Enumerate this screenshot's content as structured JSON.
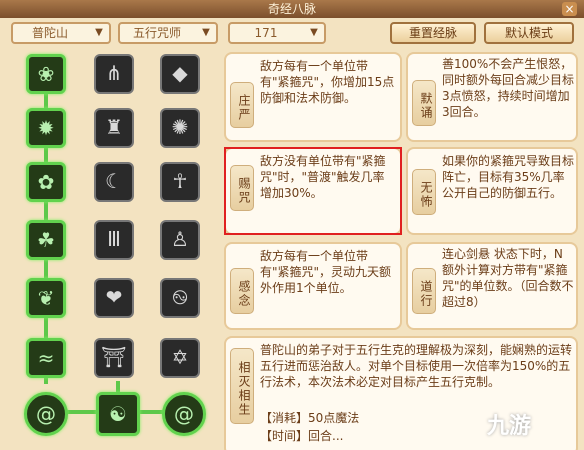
{
  "window": {
    "title": "奇经八脉",
    "close_icon": "×"
  },
  "toolbar": {
    "school_select": "普陀山",
    "category_select": "五行咒师",
    "points_select": "171",
    "reset_button": "重置经脉",
    "default_button": "默认模式"
  },
  "skills": [
    {
      "name": "庄严",
      "description": "敌方每有一个单位带有\"紧箍咒\"，你增加15点防御和法术防御。"
    },
    {
      "name": "默诵",
      "description": "善100%不会产生恨怒，同时额外每回合减少目标3点愤怒，持续时间增加3回合。"
    },
    {
      "name": "赐咒",
      "description": "敌方没有单位带有\"紧箍咒\"时，\"普渡\"触发几率增加30%。"
    },
    {
      "name": "无怖",
      "description": "如果你的紧箍咒导致目标阵亡，目标有35%几率公开自己的防御五行。"
    },
    {
      "name": "感念",
      "description": "敌方每有一个单位带有\"紧箍咒\"，灵动九天额外作用1个单位。"
    },
    {
      "name": "道行",
      "description": "连心剑悬 状态下时，N额外计算对方带有\"紧箍咒\"的单位数。（回合数不超过8）"
    },
    {
      "name": "相灭相生",
      "description": "普陀山的弟子对于五行生克的理解极为深刻，能娴熟的运转五行进而惩治敌人。对单个目标使用一次倍率为150%的五行法术，本次法术必定对目标产生五行克制。",
      "cost": "【消耗】50点魔法",
      "extra": "【时间】回合..."
    }
  ],
  "watermark": "九游"
}
